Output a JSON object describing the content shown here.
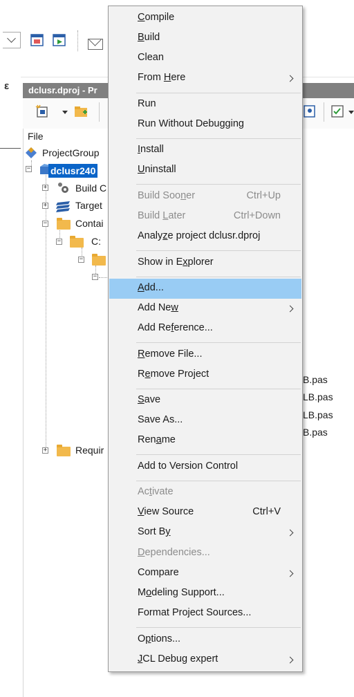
{
  "background": {
    "project_manager": {
      "title": "dclusr.dproj - Pr",
      "header": "File",
      "tree": {
        "project_group": "ProjectGroup",
        "selected_project": "dclusr240",
        "build_config": "Build C",
        "target": "Target",
        "contains": "Contai",
        "drive": "C:",
        "requires": "Requir"
      },
      "pas_fragments": [
        "B.pas",
        "LB.pas",
        "LB.pas",
        "B.pas"
      ]
    }
  },
  "context_menu": {
    "items": [
      {
        "pre": "",
        "u": "C",
        "post": "ompile",
        "disabled": false
      },
      {
        "pre": "",
        "u": "B",
        "post": "uild",
        "disabled": false
      },
      {
        "pre": "Clean",
        "u": "",
        "post": "",
        "disabled": false
      },
      {
        "pre": "From ",
        "u": "H",
        "post": "ere",
        "submenu": true,
        "disabled": false
      },
      {
        "pre": "Run",
        "u": "",
        "post": "",
        "disabled": false
      },
      {
        "pre": "Run Without Debugging",
        "u": "",
        "post": "",
        "disabled": false
      },
      {
        "pre": "",
        "u": "I",
        "post": "nstall",
        "disabled": false
      },
      {
        "pre": "",
        "u": "U",
        "post": "ninstall",
        "disabled": false
      },
      {
        "pre": "Build Soo",
        "u": "n",
        "post": "er",
        "shortcut": "Ctrl+Up",
        "disabled": true
      },
      {
        "pre": "Build ",
        "u": "L",
        "post": "ater",
        "shortcut": "Ctrl+Down",
        "disabled": true
      },
      {
        "pre": "Analy",
        "u": "z",
        "post": "e project dclusr.dproj",
        "disabled": false
      },
      {
        "pre": "Show in E",
        "u": "x",
        "post": "plorer",
        "disabled": false
      },
      {
        "pre": "",
        "u": "A",
        "post": "dd...",
        "highlighted": true,
        "disabled": false
      },
      {
        "pre": "Add Ne",
        "u": "w",
        "post": "",
        "submenu": true,
        "disabled": false
      },
      {
        "pre": "Add Re",
        "u": "f",
        "post": "erence...",
        "disabled": false
      },
      {
        "pre": "",
        "u": "R",
        "post": "emove File...",
        "disabled": false
      },
      {
        "pre": "R",
        "u": "e",
        "post": "move Project",
        "disabled": false
      },
      {
        "pre": "",
        "u": "S",
        "post": "ave",
        "disabled": false
      },
      {
        "pre": "Save As...",
        "u": "",
        "post": "",
        "disabled": false
      },
      {
        "pre": "Ren",
        "u": "a",
        "post": "me",
        "disabled": false
      },
      {
        "pre": "Add to Version Control",
        "u": "",
        "post": "",
        "disabled": false
      },
      {
        "pre": "Ac",
        "u": "t",
        "post": "ivate",
        "disabled": true
      },
      {
        "pre": "",
        "u": "V",
        "post": "iew Source",
        "shortcut": "Ctrl+V",
        "disabled": false
      },
      {
        "pre": "Sort B",
        "u": "y",
        "post": "",
        "submenu": true,
        "disabled": false
      },
      {
        "pre": "",
        "u": "D",
        "post": "ependencies...",
        "disabled": true
      },
      {
        "pre": "Compare",
        "u": "",
        "post": "",
        "submenu": true,
        "disabled": false
      },
      {
        "pre": "M",
        "u": "o",
        "post": "deling Support...",
        "disabled": false
      },
      {
        "pre": "Format Project Sources...",
        "u": "",
        "post": "",
        "disabled": false
      },
      {
        "pre": "O",
        "u": "p",
        "post": "tions...",
        "disabled": false
      },
      {
        "pre": "",
        "u": "J",
        "post": "CL Debug expert",
        "submenu": true,
        "disabled": false
      }
    ]
  }
}
